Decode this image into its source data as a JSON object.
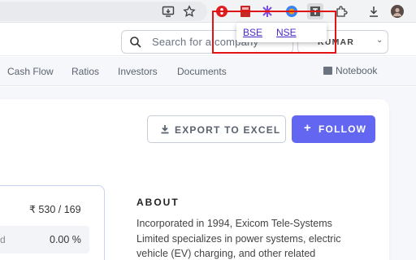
{
  "browser": {
    "extension_popup": {
      "links": [
        "BSE",
        "NSE"
      ]
    }
  },
  "header": {
    "search_placeholder": "Search for a company",
    "user_name": "KUMAR"
  },
  "tabs": [
    "Cash Flow",
    "Ratios",
    "Investors",
    "Documents"
  ],
  "notebook_label": "Notebook",
  "actions": {
    "export_label": "EXPORT TO EXCEL",
    "follow_label": "FOLLOW"
  },
  "ratios": {
    "row1_value": "₹ 530 / 169",
    "row2_label": "d",
    "row2_value": "0.00 %"
  },
  "about": {
    "heading": "ABOUT",
    "text": "Incorporated in 1994, Exicom Tele-Systems Limited specializes in power systems, electric vehicle (EV) charging, and other related"
  },
  "colors": {
    "accent": "#6366f1",
    "popup_frame": "#e01414"
  }
}
